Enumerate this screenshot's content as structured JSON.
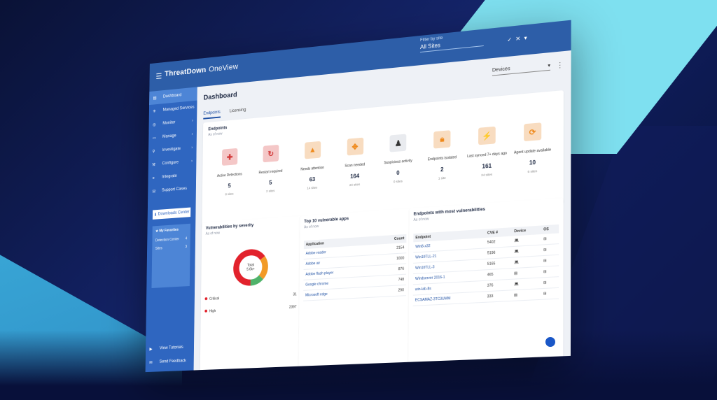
{
  "app": {
    "brand": "ThreatDown",
    "product": "OneView",
    "site_filter_label": "Filter by site",
    "site_filter_value": "All Sites",
    "accent": "#2f66c0"
  },
  "sidebar": {
    "items": [
      {
        "label": "Dashboard"
      },
      {
        "label": "Managed Services"
      },
      {
        "label": "Monitor"
      },
      {
        "label": "Manage"
      },
      {
        "label": "Investigate"
      },
      {
        "label": "Configure"
      },
      {
        "label": "Integrate"
      },
      {
        "label": "Support Cases"
      }
    ],
    "download_label": "Downloads Center",
    "favorites_title": "My Favorites",
    "favorites": [
      {
        "label": "Detection Center",
        "count": "4"
      },
      {
        "label": "Sites",
        "count": "3"
      }
    ],
    "bottom": [
      {
        "label": "View Tutorials"
      },
      {
        "label": "Send Feedback"
      }
    ]
  },
  "header": {
    "title": "Dashboard",
    "devices_select": "Devices",
    "tabs": [
      {
        "label": "Endpoints"
      },
      {
        "label": "Licensing"
      }
    ]
  },
  "endpoints": {
    "title": "Endpoints",
    "subtitle": "As of now",
    "tiles": [
      {
        "label": "Active Detections",
        "count": "5",
        "sub": "8 sites",
        "color": "#f4c7c7",
        "icon": "medkit-icon"
      },
      {
        "label": "Restart required",
        "count": "5",
        "sub": "2 sites",
        "color": "#f4c7c7",
        "icon": "restart-icon"
      },
      {
        "label": "Needs attention",
        "count": "63",
        "sub": "14 sites",
        "color": "#f8dcc0",
        "icon": "warning-icon"
      },
      {
        "label": "Scan needed",
        "count": "164",
        "sub": "24 sites",
        "color": "#f8dcc0",
        "icon": "scan-icon"
      },
      {
        "label": "Suspicious activity",
        "count": "0",
        "sub": "0 sites",
        "color": "#e9ebef",
        "icon": "suspicious-icon"
      },
      {
        "label": "Endpoints isolated",
        "count": "2",
        "sub": "1 site",
        "color": "#f8dcc0",
        "icon": "lock-icon"
      },
      {
        "label": "Last synced 7+ days ago",
        "count": "161",
        "sub": "24 sites",
        "color": "#f8dcc0",
        "icon": "plug-icon"
      },
      {
        "label": "Agent update available",
        "count": "10",
        "sub": "6 sites",
        "color": "#f8dcc0",
        "icon": "update-icon"
      }
    ]
  },
  "vulnerabilities": {
    "title": "Vulnerabilities by severity",
    "subtitle": "As of now",
    "center_label": "Total",
    "center_value": "5.6k+",
    "rows": [
      {
        "label": "Critical",
        "value": "31"
      },
      {
        "label": "High",
        "value": "2397"
      }
    ]
  },
  "top_apps": {
    "title": "Top 10 vulnerable apps",
    "subtitle": "As of now",
    "headers": [
      "Application",
      "Count"
    ],
    "rows": [
      {
        "app": "Adobe reader",
        "count": "2154"
      },
      {
        "app": "Adobe air",
        "count": "1000"
      },
      {
        "app": "Adobe flash player",
        "count": "876"
      },
      {
        "app": "Google chrome",
        "count": "748"
      },
      {
        "app": "Microsoft edge",
        "count": "290"
      }
    ]
  },
  "end_vulns": {
    "title": "Endpoints with most vulnerabilities",
    "subtitle": "As of now",
    "headers": [
      "Endpoint",
      "CVE #",
      "Device",
      "OS"
    ],
    "rows": [
      {
        "endpoint": "Win8-x32",
        "cve": "5402"
      },
      {
        "endpoint": "Win10TLL-21",
        "cve": "5196"
      },
      {
        "endpoint": "Win10TLL-3",
        "cve": "5165"
      },
      {
        "endpoint": "Windserver 2016-1",
        "cve": "465"
      },
      {
        "endpoint": "win-lab-8s",
        "cve": "376"
      },
      {
        "endpoint": "ECSAMAZ-3TC3UMM",
        "cve": "333"
      }
    ]
  }
}
